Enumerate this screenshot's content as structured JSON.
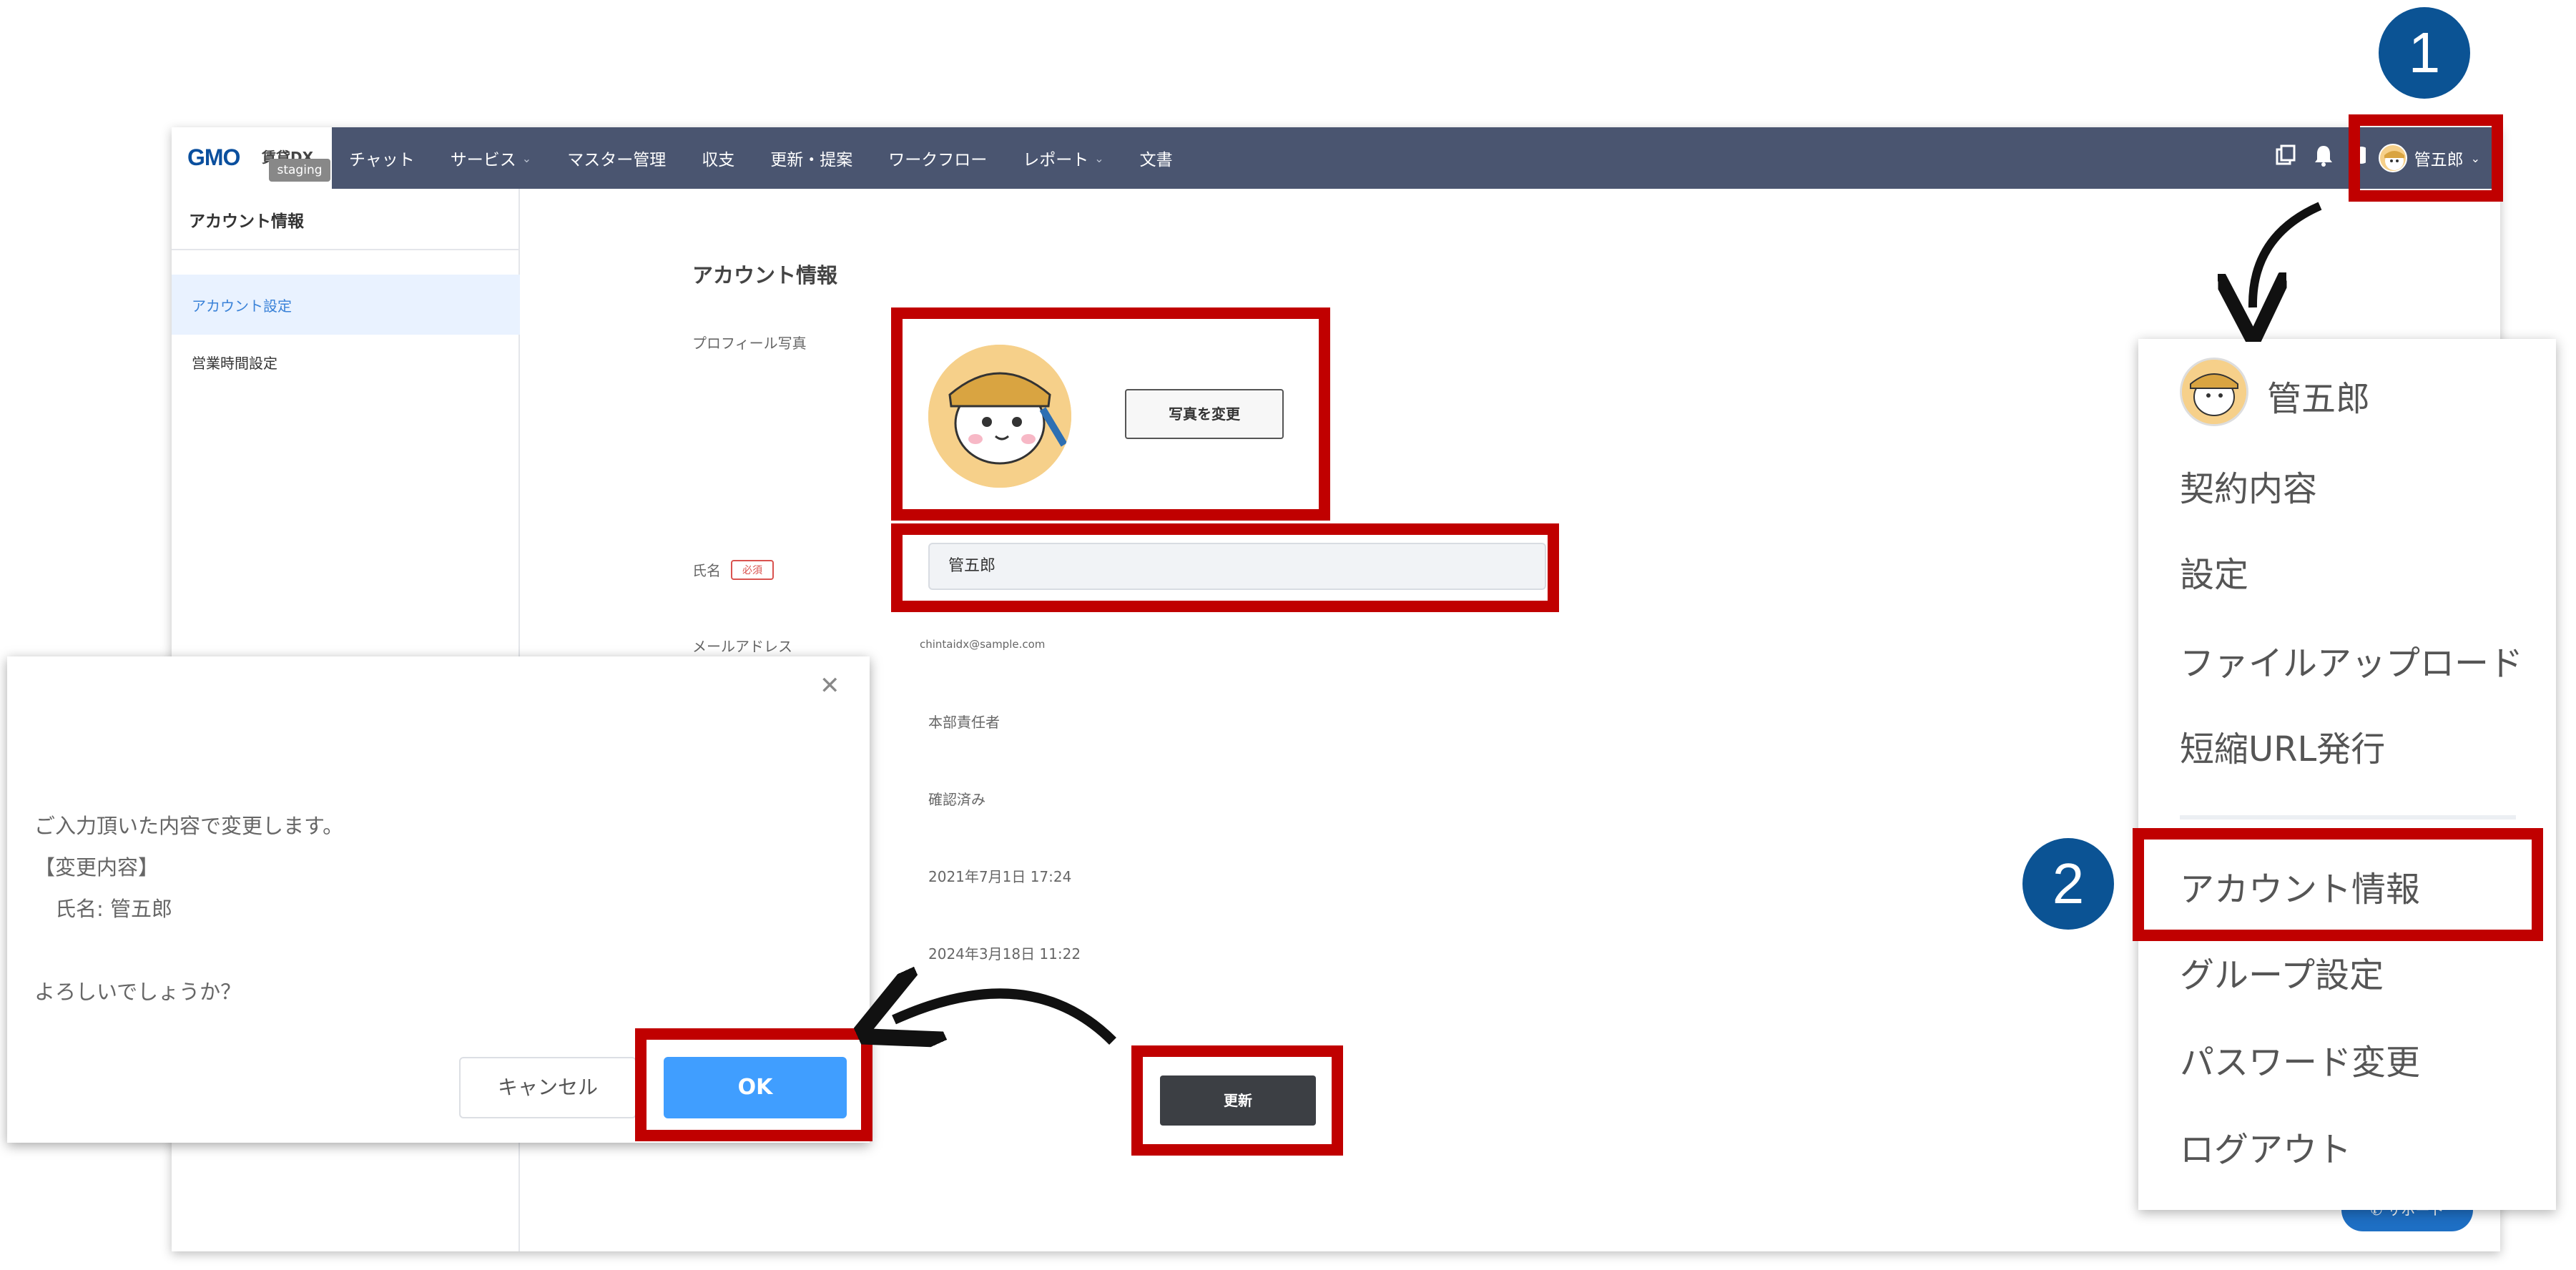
{
  "nav": {
    "logo": "GMO",
    "logo_sub": "賃貸DX",
    "env_badge": "staging",
    "items": [
      {
        "label": "チャット",
        "caret": false
      },
      {
        "label": "サービス",
        "caret": true
      },
      {
        "label": "マスター管理",
        "caret": false
      },
      {
        "label": "収支",
        "caret": false
      },
      {
        "label": "更新・提案",
        "caret": false
      },
      {
        "label": "ワークフロー",
        "caret": false
      },
      {
        "label": "レポート",
        "caret": true
      },
      {
        "label": "文書",
        "caret": false
      }
    ],
    "user_name": "管五郎",
    "icons": [
      "copy-icon",
      "bell-icon",
      "help-icon"
    ]
  },
  "sidebar": {
    "title": "アカウント情報",
    "items": [
      {
        "label": "アカウント設定",
        "active": true
      },
      {
        "label": "営業時間設定",
        "active": false
      }
    ]
  },
  "main": {
    "title": "アカウント情報",
    "photo_label": "プロフィール写真",
    "change_photo": "写真を変更",
    "name_label": "氏名",
    "required": "必須",
    "name_value": "管五郎",
    "email_label": "メールアドレス",
    "email_value": "chintaidx@sample.com",
    "role": "本部責任者",
    "verified": "確認済み",
    "created": "2021年7月1日 17:24",
    "updated": "2024年3月18日 11:22",
    "update_button": "更新",
    "support_button": "サポート"
  },
  "dialog": {
    "lines": [
      "ご入力頂いた内容で変更します。",
      "【変更内容】",
      "　氏名: 管五郎",
      "",
      "よろしいでしょうか？"
    ],
    "cancel": "キャンセル",
    "ok": "OK"
  },
  "dropdown": {
    "user": "管五郎",
    "items": [
      "契約内容",
      "設定",
      "ファイルアップロード",
      "短縮URL発行",
      "アカウント情報",
      "グループ設定",
      "パスワード変更",
      "ログアウト"
    ]
  },
  "annotations": {
    "step1": "1",
    "step2": "2"
  },
  "colors": {
    "nav_bg": "#4a5570",
    "highlight": "#c00000",
    "badge": "#0b5394",
    "primary": "#409eff"
  }
}
